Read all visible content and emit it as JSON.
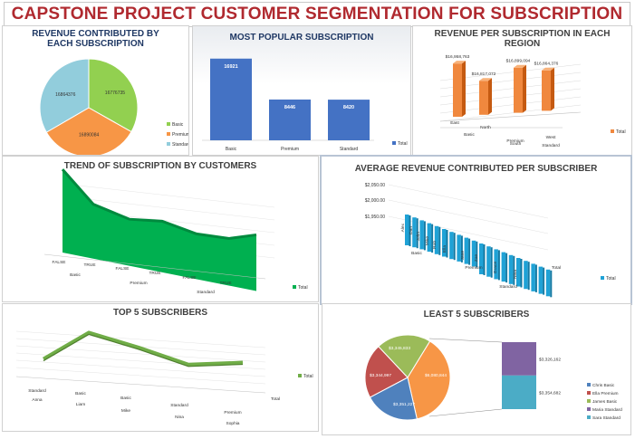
{
  "page_title": "CAPSTONE PROJECT CUSTOMER SEGMENTATION FOR SUBSCRIPTION",
  "colors": {
    "title_red": "#b0292f",
    "navy": "#1f3864",
    "bar_blue": "#4472c4",
    "orange": "#ed7d31",
    "green": "#00b050",
    "olive": "#70ad47",
    "cyan": "#1fa2d6"
  },
  "chart_data": [
    {
      "id": "revenue-by-subscription",
      "type": "pie",
      "title": "REVENUE CONTRIBUTED BY EACH SUBSCRIPTION",
      "categories": [
        "Basic",
        "Premium",
        "Standard"
      ],
      "values": [
        16776735,
        16890084,
        16864376
      ],
      "labels": [
        "16776735",
        "16890084",
        "16864376"
      ],
      "colors": [
        "#92d050",
        "#f79646",
        "#92cddc"
      ],
      "legend": "right"
    },
    {
      "id": "most-popular",
      "type": "bar",
      "title": "MOST POPULAR SUBSCRIPTION",
      "categories": [
        "Basic",
        "Premium",
        "Standard"
      ],
      "values": [
        16921,
        8446,
        8420
      ],
      "labels": [
        "16921",
        "8446",
        "8420"
      ],
      "series_name": "Total",
      "legend": "right"
    },
    {
      "id": "revenue-by-region",
      "type": "bar",
      "title": "REVENUE PER SUBSCRIPTION IN EACH REGION",
      "x": [
        "East",
        "North",
        "South",
        "West"
      ],
      "groups": [
        "Basic",
        "Premium",
        "Standard"
      ],
      "group_of_x": [
        0,
        0,
        1,
        2
      ],
      "values": [
        16958763,
        16817072,
        16899094,
        16864376
      ],
      "labels": [
        "$16,958,763",
        "$16,817,072",
        "$16,899,094",
        "$16,864,376"
      ],
      "series_name": "Total",
      "legend": "right"
    },
    {
      "id": "trend-by-customers",
      "type": "area",
      "title": "TREND OF SUBSCRIPTION BY CUSTOMERS",
      "x": [
        "FALSE",
        "TRUE",
        "FALSE",
        "TRUE",
        "FALSE",
        "TRUE"
      ],
      "groups": [
        "Basic",
        "Premium",
        "Standard"
      ],
      "values": [
        100,
        55,
        42,
        48,
        38,
        40
      ],
      "series_name": "Total",
      "legend": "right"
    },
    {
      "id": "avg-revenue-per-subscriber",
      "type": "bar",
      "title": "AVERAGE REVENUE CONTRIBUTED PER SUBSCRIBER",
      "y_ticks": [
        "$2,050.00",
        "$2,000.00",
        "$1,950.00"
      ],
      "x_labels": [
        "Alex",
        "Dan",
        "John",
        "Mike",
        "Rob",
        "Ella",
        "Jane",
        "Zoe",
        "Grace",
        "Nina"
      ],
      "groups": [
        "Basic",
        "Premium",
        "Standard"
      ],
      "values": [
        2004,
        2002,
        2000,
        1999,
        1998,
        1997,
        1996,
        1995,
        1994,
        1993,
        1992,
        1991,
        1990,
        1989,
        1988,
        1987,
        1986,
        1985,
        1984,
        1983
      ],
      "series_name": "Total",
      "legend": "right"
    },
    {
      "id": "top-5-subscribers",
      "type": "line",
      "title": "TOP 5 SUBSCRIBERS",
      "x_top": [
        "Standard",
        "Basic",
        "Basic",
        "Standard",
        "Premium"
      ],
      "x_bottom": [
        "Anna",
        "Liam",
        "Mike",
        "Nina",
        "Sophia"
      ],
      "values": [
        3,
        72,
        46,
        15,
        28
      ],
      "series_name": "Total",
      "legend": "right"
    },
    {
      "id": "least-5-subscribers",
      "type": "pie",
      "title": "LEAST 5 SUBSCRIBERS",
      "pie_labels": [
        "$6,080,844",
        "$3,351,227",
        "$3,344,997",
        "$3,345,833"
      ],
      "pie_values": [
        6080844,
        3351227,
        3344997,
        3345833
      ],
      "pie_colors": [
        "#f79646",
        "#4f81bd",
        "#c0504d",
        "#9bbb59"
      ],
      "bar_labels": [
        "$3,326,162",
        "$3,354,682"
      ],
      "bar_values": [
        3326162,
        3354682
      ],
      "bar_colors": [
        "#8064a2",
        "#4bacc6"
      ],
      "legend_items": [
        "Chris Basic",
        "Ella Premium",
        "James Basic",
        "Maria Standard",
        "Sara Standard"
      ],
      "legend_colors": [
        "#4f81bd",
        "#c0504d",
        "#9bbb59",
        "#8064a2",
        "#4bacc6"
      ],
      "legend": "right"
    }
  ]
}
